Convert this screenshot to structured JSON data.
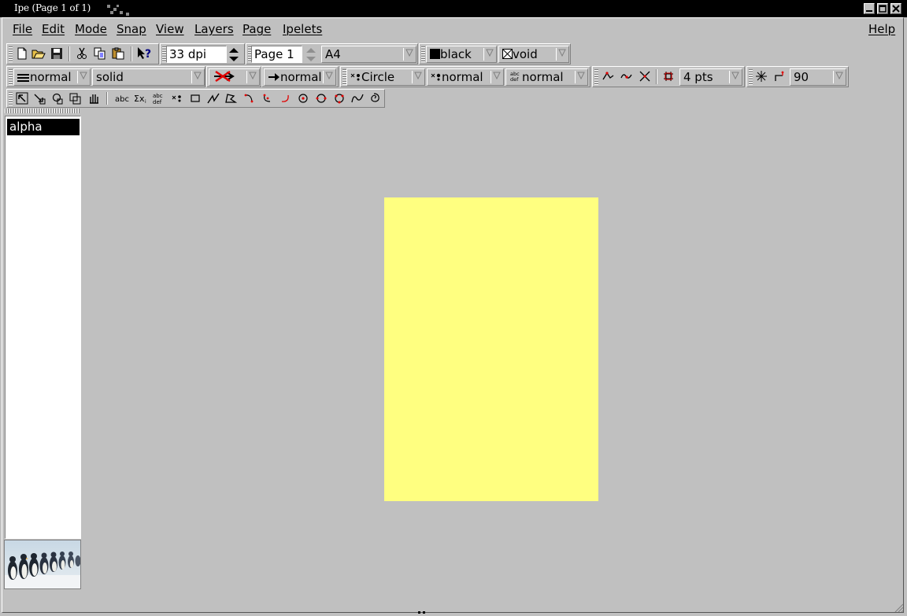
{
  "window": {
    "title": "Ipe (Page 1 of 1)",
    "controls": [
      "minimize-icon",
      "maximize-icon",
      "close-icon"
    ]
  },
  "menu": {
    "items": [
      "File",
      "Edit",
      "Mode",
      "Snap",
      "View",
      "Layers",
      "Page",
      "Ipelets"
    ],
    "help": "Help"
  },
  "toolbar_file": {
    "icons": [
      "new-file-icon",
      "open-folder-icon",
      "save-icon",
      "cut-icon",
      "copy-icon",
      "paste-icon",
      "whats-this-icon"
    ]
  },
  "resolution": {
    "value": "33 dpi"
  },
  "page_nav": {
    "value": "Page 1",
    "size": "A4"
  },
  "colors": {
    "stroke_label": "black",
    "stroke_color": "#000000",
    "fill_label": "void",
    "page_color": "#ffff80",
    "background": "#c0c0c0"
  },
  "properties": {
    "line_width": "normal",
    "dash_style": "solid",
    "arrow_size": "normal",
    "mark_shape": "Circle",
    "mark_size": "normal",
    "text_size": "normal"
  },
  "snap": {
    "grid_size": "4 pts",
    "angle": "90",
    "icons": [
      "snap-vertex-icon",
      "snap-boundary-icon",
      "snap-intersection-icon",
      "snap-grid-icon",
      "snap-angle-icon",
      "snap-auto-icon"
    ]
  },
  "modes": {
    "icons": [
      "select-mode-icon",
      "translate-mode-icon",
      "rotate-mode-icon",
      "stretch-mode-icon",
      "pan-mode-icon",
      "text-label-mode-icon",
      "math-mode-icon",
      "paragraph-mode-icon",
      "mark-mode-icon",
      "rectangle-mode-icon",
      "line-mode-icon",
      "polygon-mode-icon",
      "arc1-mode-icon",
      "arc2-mode-icon",
      "arc3-mode-icon",
      "circle-mode-icon",
      "circle-3pt-mode-icon",
      "circle-2pt-mode-icon",
      "spline-mode-icon",
      "spiral-mode-icon"
    ],
    "text_labels": {
      "label": "abc",
      "math": "Σx",
      "para1": "abc",
      "para2": "def"
    }
  },
  "layers": {
    "items": [
      "alpha"
    ],
    "selected": "alpha"
  }
}
